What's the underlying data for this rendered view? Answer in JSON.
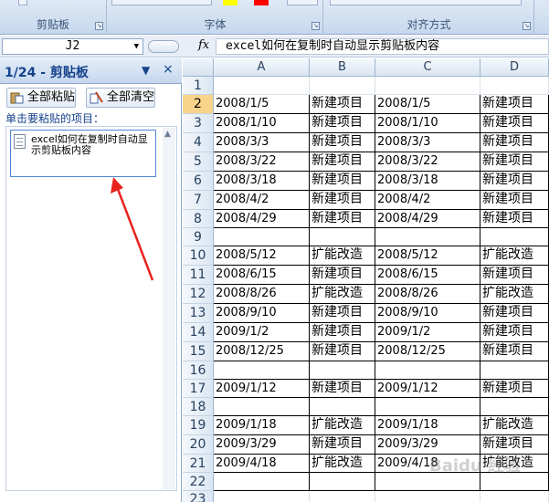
{
  "ribbon": {
    "groups": [
      {
        "label": "剪贴板"
      },
      {
        "label": "字体"
      },
      {
        "label": "对齐方式"
      }
    ],
    "colors": {
      "highlight": "#ffff00",
      "font_color": "#ff0000"
    }
  },
  "formula_bar": {
    "name_box": "J2",
    "fx": "fx",
    "content": "excel如何在复制时自动显示剪贴板内容"
  },
  "clipboard_pane": {
    "title": "1/24 - 剪贴板",
    "paste_all": "全部粘贴",
    "clear_all": "全部清空",
    "hint": "单击要粘贴的项目：",
    "items": [
      {
        "text": "excel如何在复制时自动显示剪贴板内容"
      }
    ]
  },
  "sheet": {
    "columns": [
      "A",
      "B",
      "C",
      "D"
    ],
    "rows": [
      {
        "num": "1",
        "cells": [
          "",
          "",
          "",
          ""
        ]
      },
      {
        "num": "2",
        "cells": [
          "2008/1/5",
          "新建项目",
          "2008/1/5",
          "新建项目"
        ]
      },
      {
        "num": "3",
        "cells": [
          "2008/1/10",
          "新建项目",
          "2008/1/10",
          "新建项目"
        ]
      },
      {
        "num": "4",
        "cells": [
          "2008/3/3",
          "新建项目",
          "2008/3/3",
          "新建项目"
        ]
      },
      {
        "num": "5",
        "cells": [
          "2008/3/22",
          "新建项目",
          "2008/3/22",
          "新建项目"
        ]
      },
      {
        "num": "6",
        "cells": [
          "2008/3/18",
          "新建项目",
          "2008/3/18",
          "新建项目"
        ]
      },
      {
        "num": "7",
        "cells": [
          "2008/4/2",
          "新建项目",
          "2008/4/2",
          "新建项目"
        ]
      },
      {
        "num": "8",
        "cells": [
          "2008/4/29",
          "新建项目",
          "2008/4/29",
          "新建项目"
        ]
      },
      {
        "num": "9",
        "cells": [
          "",
          "",
          "",
          ""
        ]
      },
      {
        "num": "10",
        "cells": [
          "2008/5/12",
          "扩能改造",
          "2008/5/12",
          "扩能改造"
        ]
      },
      {
        "num": "11",
        "cells": [
          "2008/6/15",
          "新建项目",
          "2008/6/15",
          "新建项目"
        ]
      },
      {
        "num": "12",
        "cells": [
          "2008/8/26",
          "扩能改造",
          "2008/8/26",
          "扩能改造"
        ]
      },
      {
        "num": "13",
        "cells": [
          "2008/9/10",
          "新建项目",
          "2008/9/10",
          "新建项目"
        ]
      },
      {
        "num": "14",
        "cells": [
          "2009/1/2",
          "新建项目",
          "2009/1/2",
          "新建项目"
        ]
      },
      {
        "num": "15",
        "cells": [
          "2008/12/25",
          "新建项目",
          "2008/12/25",
          "新建项目"
        ]
      },
      {
        "num": "16",
        "cells": [
          "",
          "",
          "",
          ""
        ]
      },
      {
        "num": "17",
        "cells": [
          "2009/1/12",
          "新建项目",
          "2009/1/12",
          "新建项目"
        ]
      },
      {
        "num": "18",
        "cells": [
          "",
          "",
          "",
          ""
        ]
      },
      {
        "num": "19",
        "cells": [
          "2009/1/18",
          "扩能改造",
          "2009/1/18",
          "扩能改造"
        ]
      },
      {
        "num": "20",
        "cells": [
          "2009/3/29",
          "新建项目",
          "2009/3/29",
          "新建项目"
        ]
      },
      {
        "num": "21",
        "cells": [
          "2009/4/18",
          "扩能改造",
          "2009/4/18",
          "扩能改造"
        ]
      },
      {
        "num": "22",
        "cells": [
          "",
          "",
          "",
          ""
        ]
      },
      {
        "num": "23",
        "cells": [
          "",
          "",
          "",
          ""
        ]
      }
    ]
  },
  "watermark": "Baidu 经验",
  "annotation_color": "#e8231f"
}
